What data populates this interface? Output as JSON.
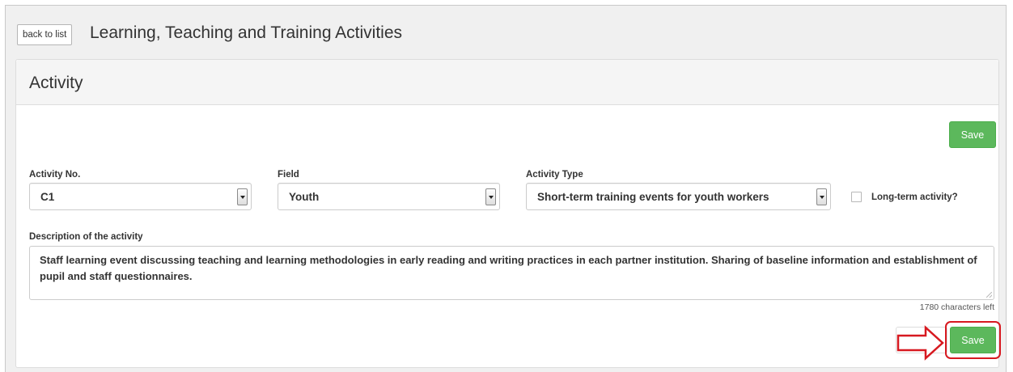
{
  "header": {
    "back_button_label": "back to list",
    "title": "Learning, Teaching and Training Activities"
  },
  "panel": {
    "title": "Activity",
    "save_label": "Save"
  },
  "form": {
    "activity_no": {
      "label": "Activity No.",
      "value": "C1"
    },
    "field": {
      "label": "Field",
      "value": "Youth"
    },
    "activity_type": {
      "label": "Activity Type",
      "value": "Short-term training events for youth workers"
    },
    "long_term": {
      "label": "Long-term activity?",
      "checked": false
    },
    "description": {
      "label": "Description of the activity",
      "value": "Staff learning event discussing teaching and learning methodologies in early reading and writing practices in each partner institution. Sharing of baseline information and establishment of pupil and staff questionnaires.",
      "chars_left": "1780 characters left"
    }
  },
  "footer": {
    "save_label": "Save"
  },
  "annotations": {
    "highlight_color": "#d71920"
  },
  "colors": {
    "success": "#5cb85c",
    "page_bg": "#f0f0f0"
  }
}
